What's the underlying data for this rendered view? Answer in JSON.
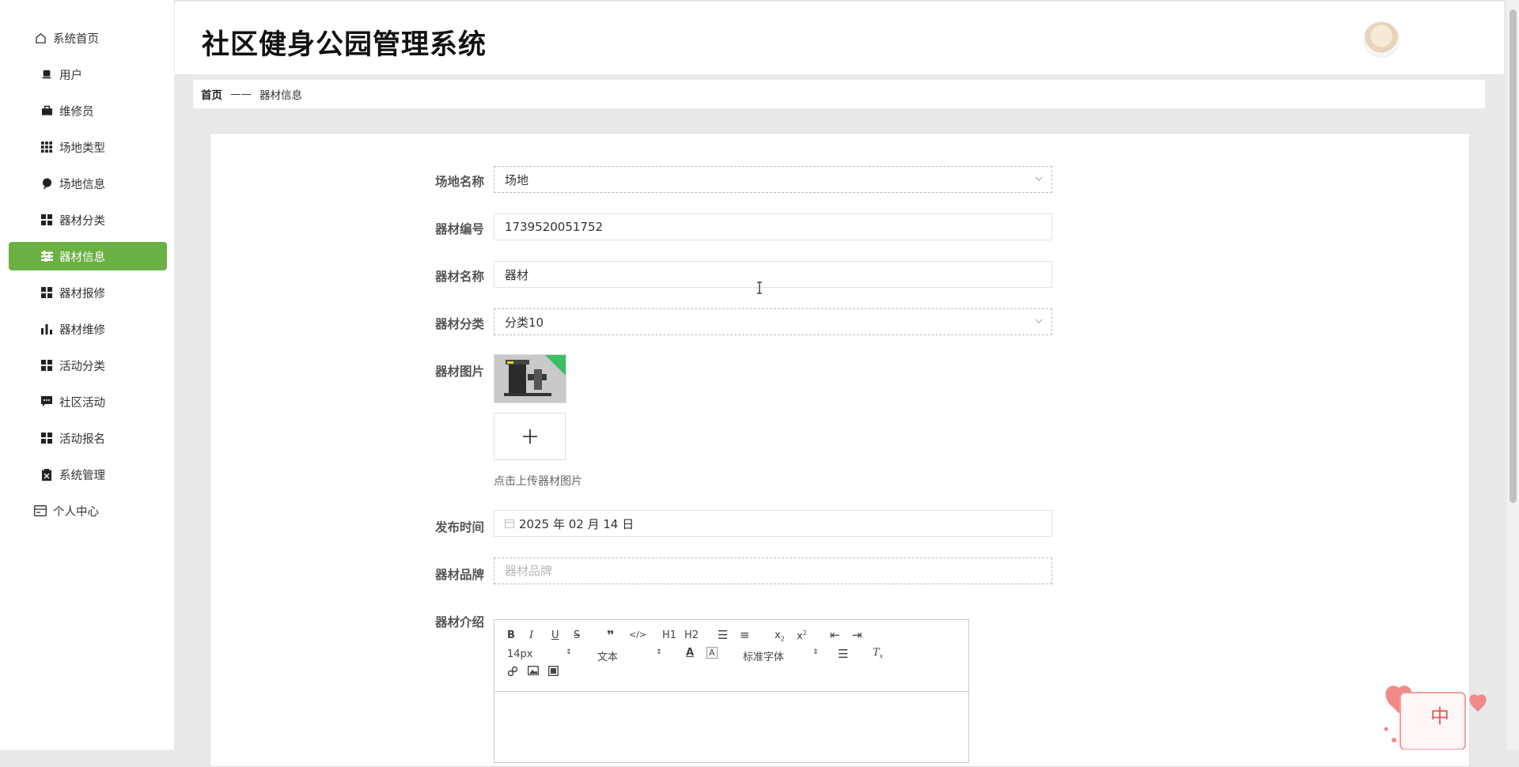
{
  "app": {
    "title": "社区健身公园管理系统"
  },
  "sidebar": {
    "items": [
      {
        "label": "系统首页",
        "icon": "home-icon"
      },
      {
        "label": "用户",
        "icon": "user-icon"
      },
      {
        "label": "维修员",
        "icon": "briefcase-icon"
      },
      {
        "label": "场地类型",
        "icon": "grid-icon"
      },
      {
        "label": "场地信息",
        "icon": "location-icon"
      },
      {
        "label": "器材分类",
        "icon": "apps-icon"
      },
      {
        "label": "器材信息",
        "icon": "sliders-icon",
        "active": true
      },
      {
        "label": "器材报修",
        "icon": "apps-icon"
      },
      {
        "label": "器材维修",
        "icon": "bar-chart-icon"
      },
      {
        "label": "活动分类",
        "icon": "apps-icon"
      },
      {
        "label": "社区活动",
        "icon": "chat-icon"
      },
      {
        "label": "活动报名",
        "icon": "apps-icon"
      },
      {
        "label": "系统管理",
        "icon": "clipboard-icon"
      },
      {
        "label": "个人中心",
        "icon": "id-card-icon"
      }
    ]
  },
  "breadcrumb": {
    "home": "首页",
    "separator": "——",
    "current": "器材信息"
  },
  "form": {
    "venue_name": {
      "label": "场地名称",
      "value": "场地"
    },
    "equipment_no": {
      "label": "器材编号",
      "value": "1739520051752"
    },
    "equipment_name": {
      "label": "器材名称",
      "value": "器材"
    },
    "equipment_category": {
      "label": "器材分类",
      "value": "分类10"
    },
    "equipment_image": {
      "label": "器材图片",
      "upload_hint": "点击上传器材图片"
    },
    "publish_time": {
      "label": "发布时间",
      "value": "2025 年 02 月 14 日"
    },
    "equipment_brand": {
      "label": "器材品牌",
      "value": "",
      "placeholder": "器材品牌"
    },
    "equipment_intro": {
      "label": "器材介绍"
    }
  },
  "editor": {
    "font_size": "14px",
    "block_type": "文本",
    "font_family": "标准字体",
    "h1": "H1",
    "h2": "H2"
  },
  "colors": {
    "accent": "#6ab043",
    "accent_corner": "#3cbf63"
  }
}
